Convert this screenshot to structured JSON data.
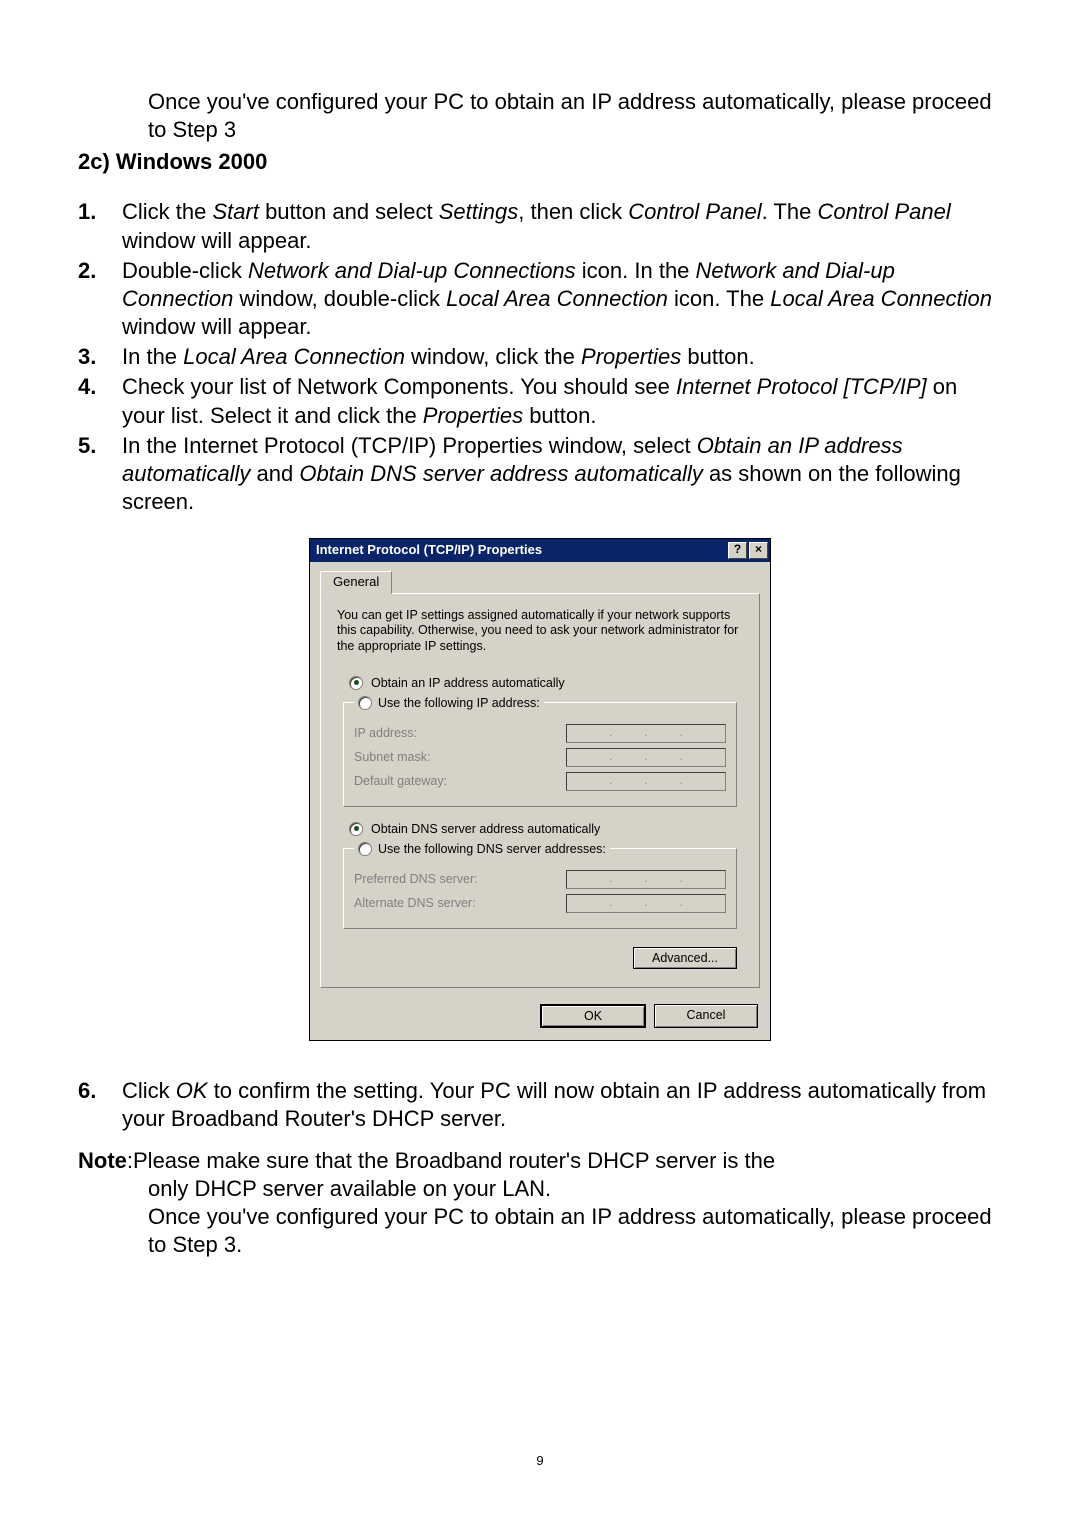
{
  "introText": "Once you've configured your PC to obtain an IP address automatically, please proceed to Step 3",
  "sectionHeading": "2c) Windows 2000",
  "steps": [
    {
      "num": "1.",
      "parts": [
        "Click the ",
        "Start",
        " button and select ",
        "Settings",
        ", then click ",
        "Control Panel",
        ". The ",
        "Control Panel",
        " window will appear."
      ]
    },
    {
      "num": "2.",
      "parts": [
        "Double-click ",
        "Network and Dial-up Connections",
        " icon. In the ",
        "Network and Dial-up Connection",
        "  window, double-click ",
        "Local Area Connection",
        " icon. The ",
        "Local Area Connection",
        " window will appear."
      ]
    },
    {
      "num": "3.",
      "parts": [
        "In the ",
        "Local Area Connection",
        " window, click the ",
        "Properties",
        " button."
      ]
    },
    {
      "num": "4.",
      "parts": [
        "Check your list of Network Components. You should see ",
        "Internet Protocol [TCP/IP]",
        " on your list. Select it and click the ",
        "Properties",
        " button."
      ]
    },
    {
      "num": "5.",
      "parts": [
        "In the Internet Protocol (TCP/IP) Properties window, select ",
        "Obtain an IP address automatically",
        " and ",
        "Obtain DNS server address automatically",
        " as shown on the following screen."
      ]
    }
  ],
  "dialog": {
    "title": "Internet Protocol (TCP/IP) Properties",
    "help": "?",
    "close": "×",
    "tab": "General",
    "desc": "You can get IP settings assigned automatically if your network supports this capability. Otherwise, you need to ask your network administrator for the appropriate IP settings.",
    "radioIpAuto": "Obtain an IP address automatically",
    "radioIpManual": "Use the following IP address:",
    "ipAddressLabel": "IP address:",
    "subnetLabel": "Subnet mask:",
    "gatewayLabel": "Default gateway:",
    "radioDnsAuto": "Obtain DNS server address automatically",
    "radioDnsManual": "Use the following DNS server addresses:",
    "prefDnsLabel": "Preferred DNS server:",
    "altDnsLabel": "Alternate DNS server:",
    "advanced": "Advanced...",
    "ok": "OK",
    "cancel": "Cancel"
  },
  "step6": {
    "num": "6.",
    "parts": [
      "Click ",
      "OK",
      " to confirm the setting. Your PC will now obtain an IP address automatically from your Broadband Router's DHCP server."
    ]
  },
  "note": {
    "label": "Note",
    "line1": ":Please make sure that the Broadband router's DHCP server is the",
    "line2": "only DHCP server  available on your LAN.",
    "line3": "Once you've configured your PC to obtain an IP address automatically, please proceed to Step 3."
  },
  "pageNumber": "9"
}
